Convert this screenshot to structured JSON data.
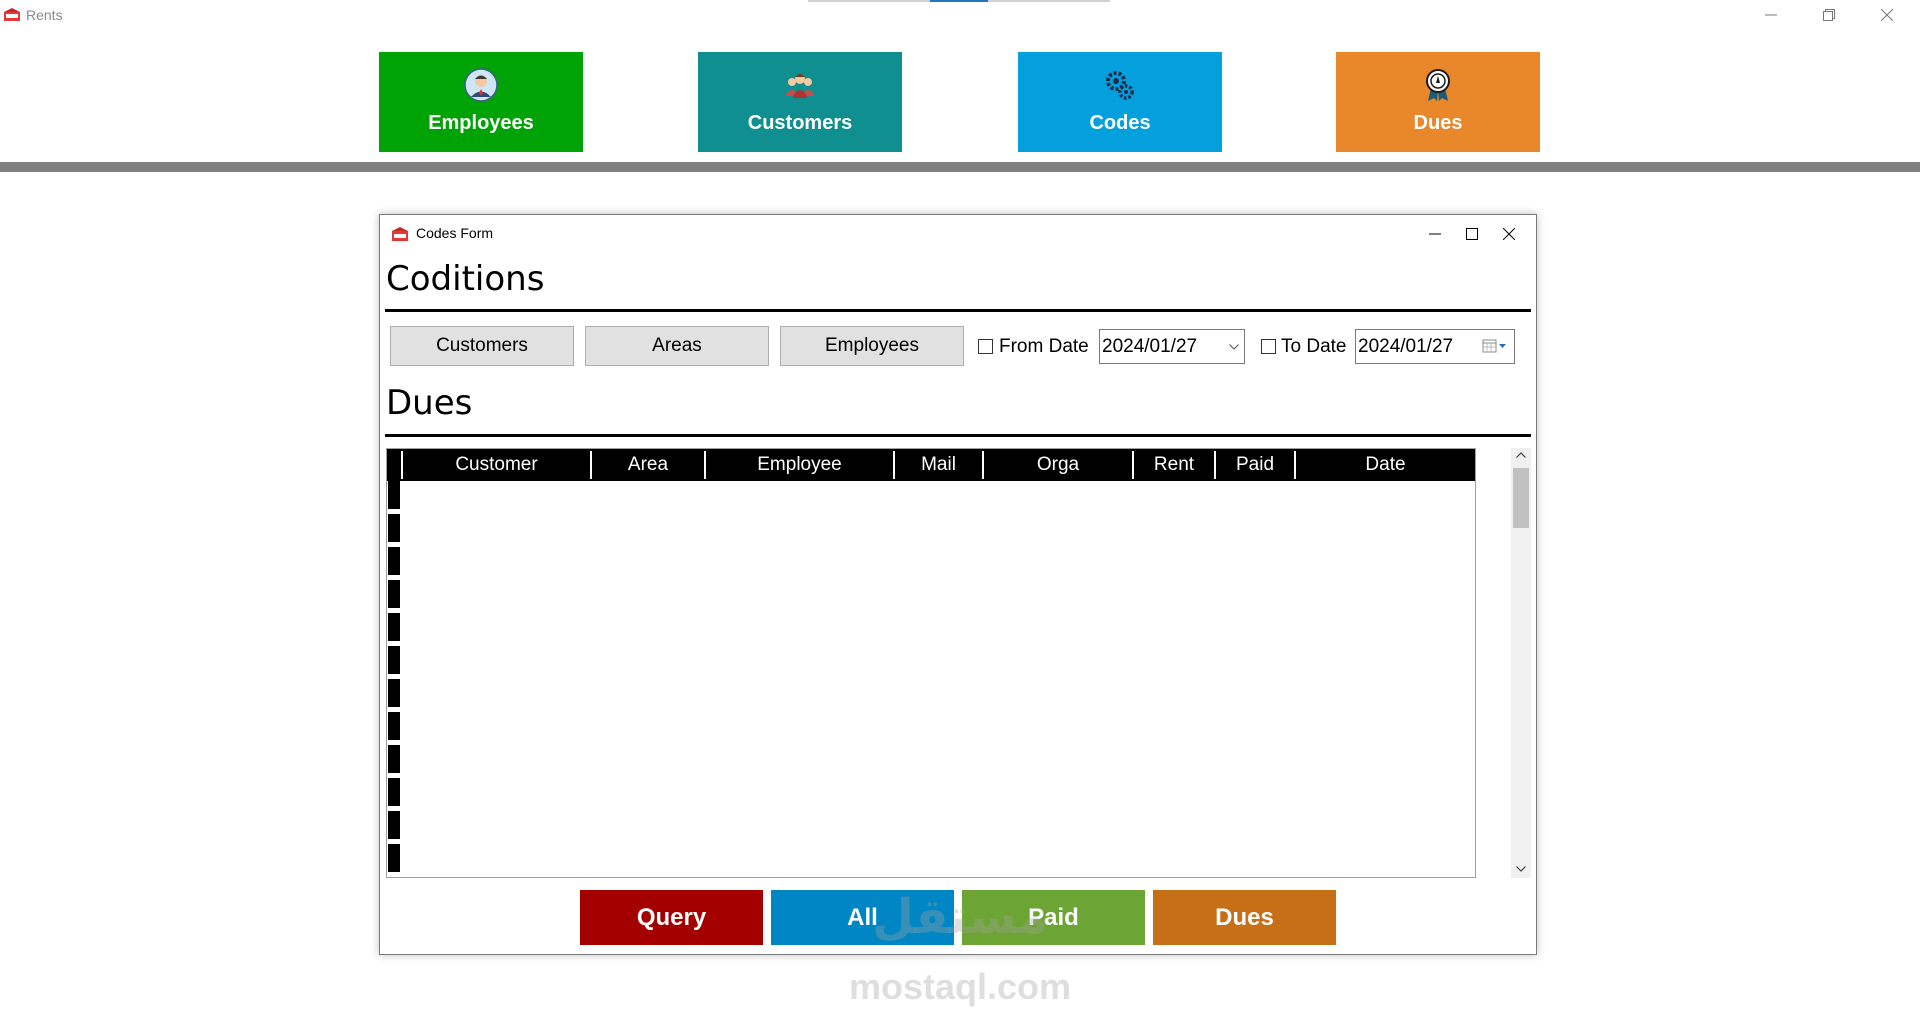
{
  "window": {
    "title": "Rents",
    "minimize_glyph": "—",
    "restore_glyph": "❐",
    "close_glyph": "✕"
  },
  "nav": [
    {
      "label": "Employees",
      "icon": "employee-icon",
      "color": "#00a305"
    },
    {
      "label": "Customers",
      "icon": "customers-icon",
      "color": "#0f8f8f"
    },
    {
      "label": "Codes",
      "icon": "gears-icon",
      "color": "#04a0dd"
    },
    {
      "label": "Dues",
      "icon": "award-icon",
      "color": "#e8882a"
    }
  ],
  "form": {
    "title": "Codes Form",
    "section1": "Coditions",
    "section2": "Dues",
    "buttons": [
      "Customers",
      "Areas",
      "Employees"
    ],
    "from_label": "From Date",
    "from_value": "2024/01/27",
    "to_label": "To Date",
    "to_value": "2024/01/27",
    "from_checked": false,
    "to_checked": false
  },
  "grid": {
    "columns": [
      "Customer",
      "Area",
      "Employee",
      "Mail",
      "Orga",
      "Rent",
      "Paid",
      "Date"
    ],
    "rows": []
  },
  "actions": [
    {
      "label": "Query",
      "color": "#a50000"
    },
    {
      "label": "All",
      "color": "#0086c4"
    },
    {
      "label": "Paid",
      "color": "#6ca534"
    },
    {
      "label": "Dues",
      "color": "#c76f17"
    }
  ],
  "watermark": {
    "arabic": "مستقل",
    "latin": "mostaql.com"
  }
}
